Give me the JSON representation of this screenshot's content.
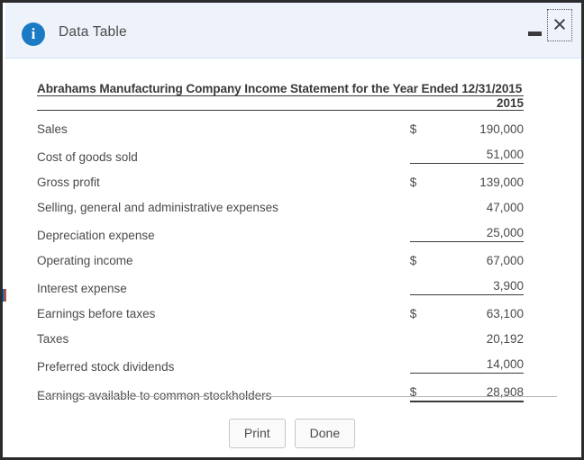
{
  "window": {
    "title": "Data Table",
    "info_icon": "info-circle-icon",
    "minimize_label": "–",
    "close_label": "×"
  },
  "statement": {
    "title": "Abrahams Manufacturing Company Income Statement for the Year Ended 12/31/2015",
    "year_header": "2015",
    "currency_symbol": "$",
    "rows": [
      {
        "label": "Sales",
        "currency": "$",
        "value": "190,000",
        "rule": "none"
      },
      {
        "label": "Cost of goods sold",
        "currency": "",
        "value": "51,000",
        "rule": "single"
      },
      {
        "label": "Gross profit",
        "currency": "$",
        "value": "139,000",
        "rule": "none"
      },
      {
        "label": "Selling, general and administrative expenses",
        "currency": "",
        "value": "47,000",
        "rule": "none"
      },
      {
        "label": "Depreciation expense",
        "currency": "",
        "value": "25,000",
        "rule": "single"
      },
      {
        "label": "Operating income",
        "currency": "$",
        "value": "67,000",
        "rule": "none"
      },
      {
        "label": "Interest expense",
        "currency": "",
        "value": "3,900",
        "rule": "single"
      },
      {
        "label": "Earnings before taxes",
        "currency": "$",
        "value": "63,100",
        "rule": "none"
      },
      {
        "label": "Taxes",
        "currency": "",
        "value": "20,192",
        "rule": "none"
      },
      {
        "label": "Preferred stock dividends",
        "currency": "",
        "value": "14,000",
        "rule": "single"
      },
      {
        "label": "Earnings available to common stockholders",
        "currency": "$",
        "value": "28,908",
        "rule": "double"
      }
    ]
  },
  "footer": {
    "print_label": "Print",
    "done_label": "Done"
  },
  "colors": {
    "titlebar_bg": "#eef3fb",
    "info_icon_bg": "#1a7ac4",
    "text": "#4a4a4a",
    "rule": "#3a3a3a",
    "border": "#2b2b2b"
  }
}
